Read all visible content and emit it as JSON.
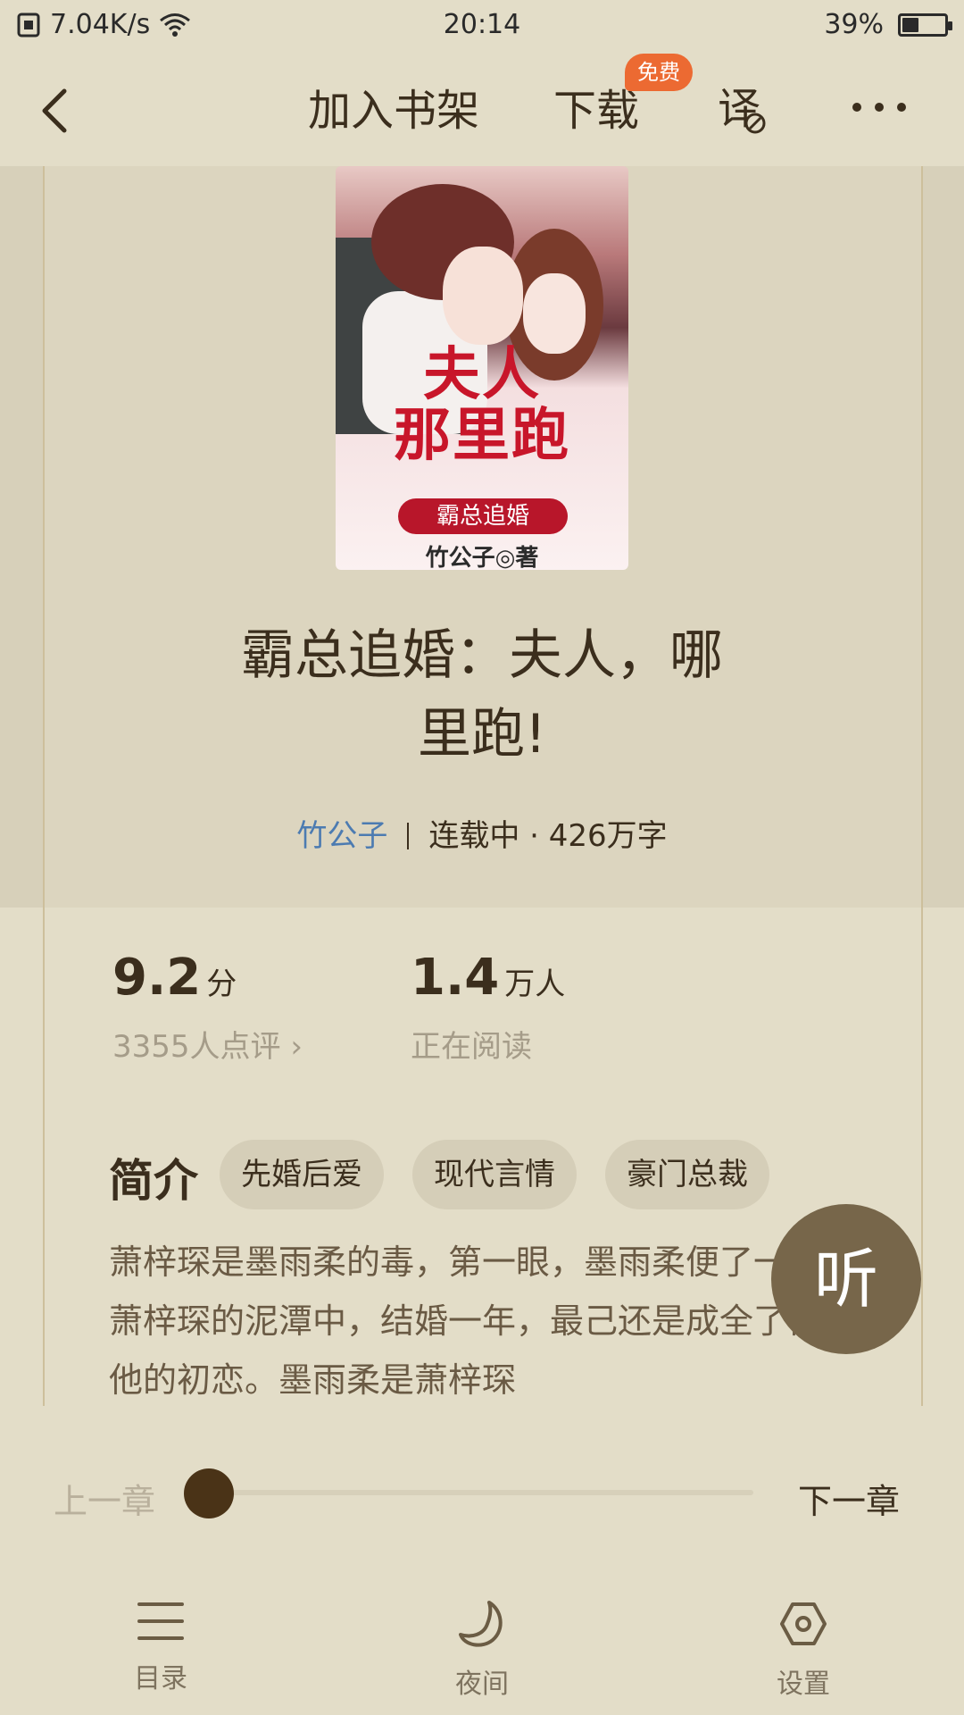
{
  "status_bar": {
    "network_speed": "7.04K/s",
    "time": "20:14",
    "battery_percent": "39%",
    "battery_level": 0.39
  },
  "toolbar": {
    "add_to_shelf": "加入书架",
    "download": "下载",
    "free_badge": "免费",
    "simplified_toggle": "译"
  },
  "book": {
    "cover": {
      "title_line1": "夫人",
      "title_line2": "那里跑",
      "subtitle": "霸总追婚",
      "author": "竹公子◎著"
    },
    "title_line1": "霸总追婚：夫人，哪",
    "title_line2": "里跑!",
    "author": "竹公子",
    "status": "连载中 · 426万字"
  },
  "stats": {
    "rating": "9.2",
    "rating_unit": "分",
    "reviews": "3355人点评 ›",
    "readers": "1.4",
    "readers_unit": "万人",
    "readers_label": "正在阅读"
  },
  "intro": {
    "label": "简介",
    "tags": [
      "先婚后爱",
      "现代言情",
      "豪门总裁"
    ],
    "text": "萧梓琛是墨雨柔的毒，第一眼，墨雨柔便了一个叫萧梓琛的泥潭中，结婚一年，最己还是成全了他和他的初恋。墨雨柔是萧梓琛"
  },
  "listen_button": "听",
  "chapter_nav": {
    "prev": "上一章",
    "next": "下一章",
    "progress": 0.0
  },
  "bottom_nav": {
    "items": [
      "目录",
      "夜间",
      "设置"
    ]
  }
}
